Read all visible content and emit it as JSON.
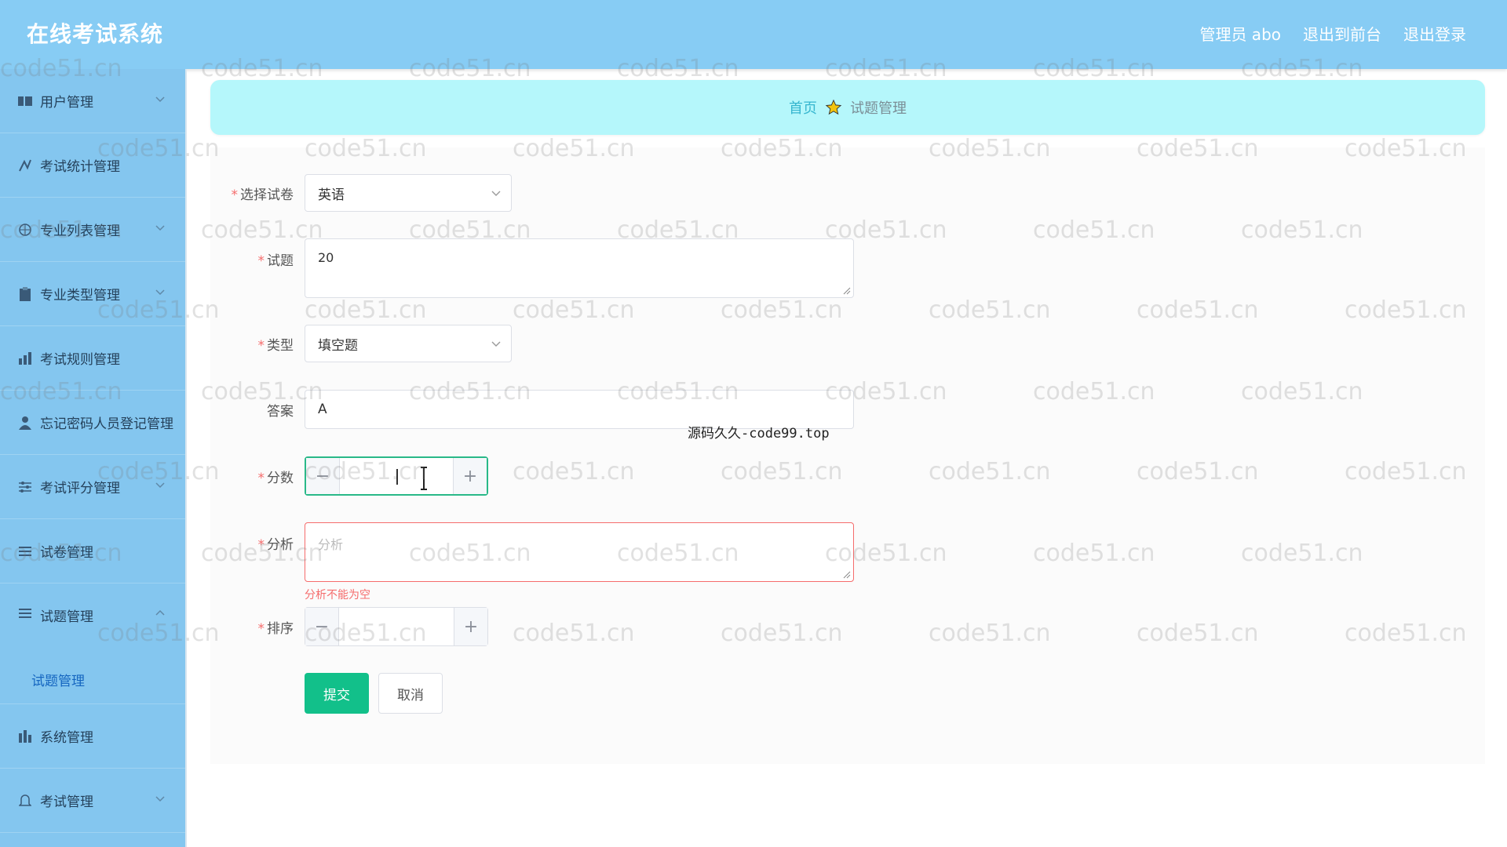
{
  "header": {
    "brand": "在线考试系统",
    "user_label": "管理员 abo",
    "to_frontend": "退出到前台",
    "logout": "退出登录"
  },
  "sidebar": {
    "items": [
      {
        "label": "用户管理",
        "icon": "users-icon"
      },
      {
        "label": "考试统计管理",
        "icon": "chart-icon"
      },
      {
        "label": "专业列表管理",
        "icon": "globe-icon"
      },
      {
        "label": "专业类型管理",
        "icon": "clipboard-icon"
      },
      {
        "label": "考试规则管理",
        "icon": "rules-icon"
      },
      {
        "label": "忘记密码人员登记管理",
        "icon": "person-icon"
      },
      {
        "label": "考试评分管理",
        "icon": "sliders-icon"
      },
      {
        "label": "试卷管理",
        "icon": "list-icon"
      },
      {
        "label": "试题管理",
        "icon": "list-icon",
        "sub": "试题管理"
      },
      {
        "label": "系统管理",
        "icon": "bar-icon"
      },
      {
        "label": "考试管理",
        "icon": "bell-icon"
      }
    ]
  },
  "breadcrumb": {
    "home": "首页",
    "current": "试题管理"
  },
  "form": {
    "paper_label": "选择试卷",
    "paper_value": "英语",
    "question_label": "试题",
    "question_value": "20",
    "type_label": "类型",
    "type_value": "填空题",
    "answer_label": "答案",
    "answer_value": "A",
    "score_label": "分数",
    "score_minus": "−",
    "score_plus": "+",
    "analysis_label": "分析",
    "analysis_placeholder": "分析",
    "analysis_error": "分析不能为空",
    "order_label": "排序",
    "order_minus": "−",
    "order_plus": "+",
    "submit": "提交",
    "cancel": "取消"
  },
  "overlay": "源码久久-code99.top",
  "watermark": "code51.cn",
  "colors": {
    "header": "#87ccf4",
    "sidebar": "#84c6ef",
    "breadcrumb": "#b5f7fb",
    "accent_green": "#12c08a",
    "error": "#f56c6c"
  }
}
